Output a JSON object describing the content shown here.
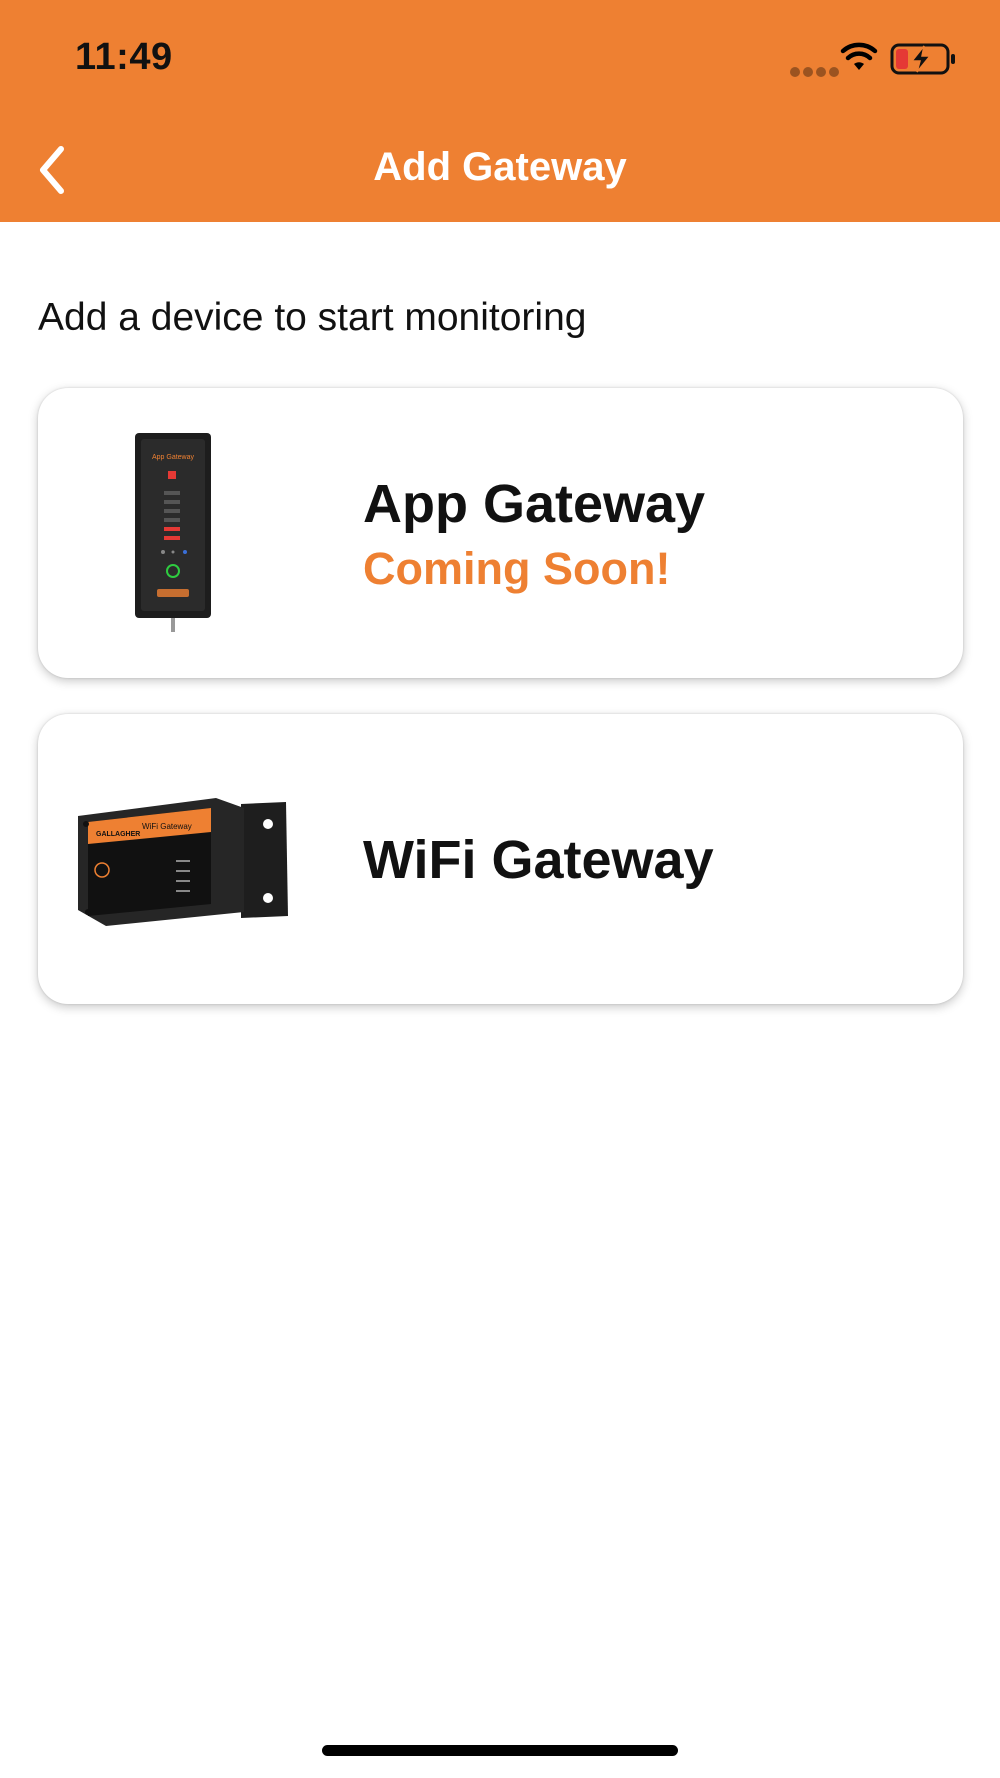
{
  "status_bar": {
    "time": "11:49",
    "icons": [
      "signal-dots-icon",
      "wifi-icon",
      "battery-charging-icon"
    ]
  },
  "nav": {
    "title": "Add Gateway",
    "back_icon": "chevron-left-icon"
  },
  "subtitle": "Add a device to start monitoring",
  "devices": [
    {
      "title": "App Gateway",
      "note": "Coming Soon!",
      "image": "app-gateway-device",
      "device_label": "App Gateway"
    },
    {
      "title": "WiFi Gateway",
      "image": "wifi-gateway-device",
      "device_label": "WiFi Gateway",
      "brand": "GALLAGHER"
    }
  ],
  "colors": {
    "accent": "#EE8032",
    "background": "#FFFFFF",
    "text": "#111111",
    "battery_low": "#E53935"
  }
}
